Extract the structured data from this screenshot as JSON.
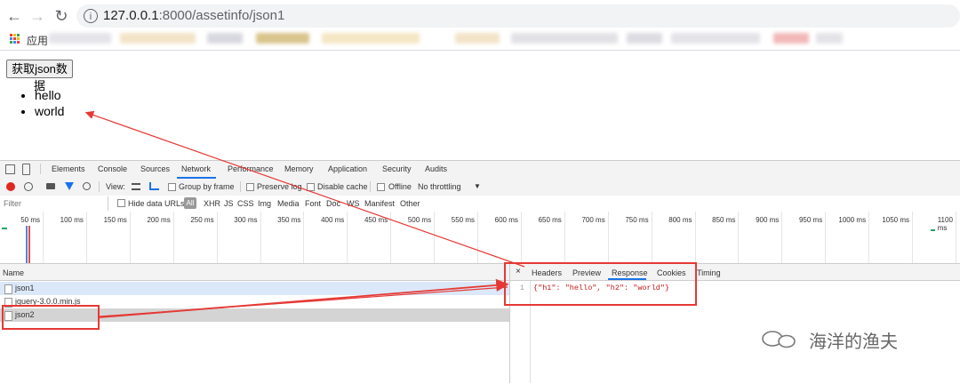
{
  "browser": {
    "url_host": "127.0.0.1",
    "url_path": ":8000/assetinfo/json1",
    "apps_label": "应用"
  },
  "page": {
    "button_label": "获取json数据",
    "list_items": [
      "hello",
      "world"
    ]
  },
  "devtools": {
    "tabs": [
      "Elements",
      "Console",
      "Sources",
      "Network",
      "Performance",
      "Memory",
      "Application",
      "Security",
      "Audits"
    ],
    "active_tab": "Network",
    "toolbar": {
      "view_label": "View:",
      "group_by_frame": "Group by frame",
      "preserve_log": "Preserve log",
      "disable_cache": "Disable cache",
      "offline": "Offline",
      "throttling": "No throttling"
    },
    "filter": {
      "placeholder": "Filter",
      "hide_data_urls": "Hide data URLs",
      "types": [
        "All",
        "XHR",
        "JS",
        "CSS",
        "Img",
        "Media",
        "Font",
        "Doc",
        "WS",
        "Manifest",
        "Other"
      ]
    },
    "timeline_ticks": [
      "50 ms",
      "100 ms",
      "150 ms",
      "200 ms",
      "250 ms",
      "300 ms",
      "350 ms",
      "400 ms",
      "450 ms",
      "500 ms",
      "550 ms",
      "600 ms",
      "650 ms",
      "700 ms",
      "750 ms",
      "800 ms",
      "850 ms",
      "900 ms",
      "950 ms",
      "1000 ms",
      "1050 ms",
      "1100 ms"
    ],
    "name_header": "Name",
    "requests": [
      "json1",
      "jquery-3.0.0.min.js",
      "json2"
    ],
    "detail_tabs": [
      "Headers",
      "Preview",
      "Response",
      "Cookies",
      "Timing"
    ],
    "active_detail_tab": "Response",
    "response_line_number": "1",
    "response_body": "{\"h1\": \"hello\", \"h2\": \"world\"}"
  },
  "watermark": "海洋的渔夫",
  "colors": {
    "annotation_red": "#e53935",
    "selected_row": "#dbe8f9",
    "highlight_row": "#d4d4d4",
    "record_red": "#e0281f",
    "filter_blue": "#1a73e8"
  }
}
